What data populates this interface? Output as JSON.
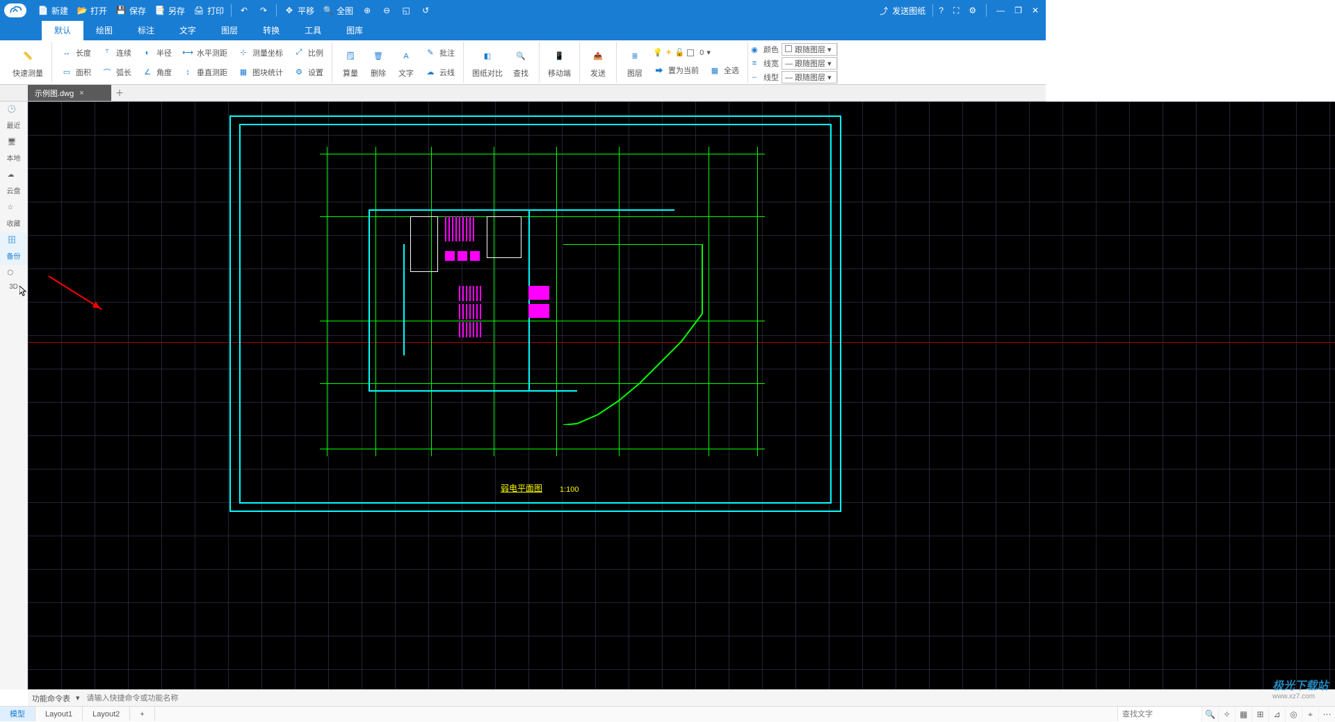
{
  "titlebar": {
    "new": "新建",
    "open": "打开",
    "save": "保存",
    "saveas": "另存",
    "print": "打印",
    "pan": "平移",
    "full": "全图",
    "send": "发送图纸"
  },
  "menu": {
    "tabs": [
      "默认",
      "绘图",
      "标注",
      "文字",
      "图层",
      "转换",
      "工具",
      "图库"
    ],
    "active": 0
  },
  "ribbon": {
    "quickmeasure": "快速测量",
    "length": "长度",
    "continuous": "连续",
    "radius": "半径",
    "hdist": "水平测距",
    "coord": "测量坐标",
    "scale": "比例",
    "area": "面积",
    "arc": "弧长",
    "angle": "角度",
    "vdist": "垂直测距",
    "blockstat": "图块统计",
    "settings": "设置",
    "sum": "算量",
    "delete": "删除",
    "text": "文字",
    "annotate": "批注",
    "cloud": "云线",
    "compare": "图纸对比",
    "find": "查找",
    "mobile": "移动端",
    "send": "发送",
    "layer": "图层",
    "setcurrent": "置为当前",
    "selectall": "全选",
    "color": "颜色",
    "lineweight": "线宽",
    "linetype": "线型",
    "bylayer": "跟随图层",
    "layernum": "0"
  },
  "doctab": {
    "name": "示例图.dwg"
  },
  "leftbar": {
    "recent": "最近",
    "local": "本地",
    "cloud": "云盘",
    "favorite": "收藏",
    "backup": "备份",
    "threeD": "3D"
  },
  "drawing": {
    "title": "弱电平面图",
    "scale": "1:100"
  },
  "cmdbar": {
    "label": "功能命令表",
    "placeholder": "请输入快捷命令或功能名称"
  },
  "layouts": {
    "items": [
      "模型",
      "Layout1",
      "Layout2"
    ],
    "active": 0
  },
  "searchPlaceholder": "查找文字",
  "watermark": {
    "brand": "极光下载站",
    "url": "www.xz7.com"
  }
}
